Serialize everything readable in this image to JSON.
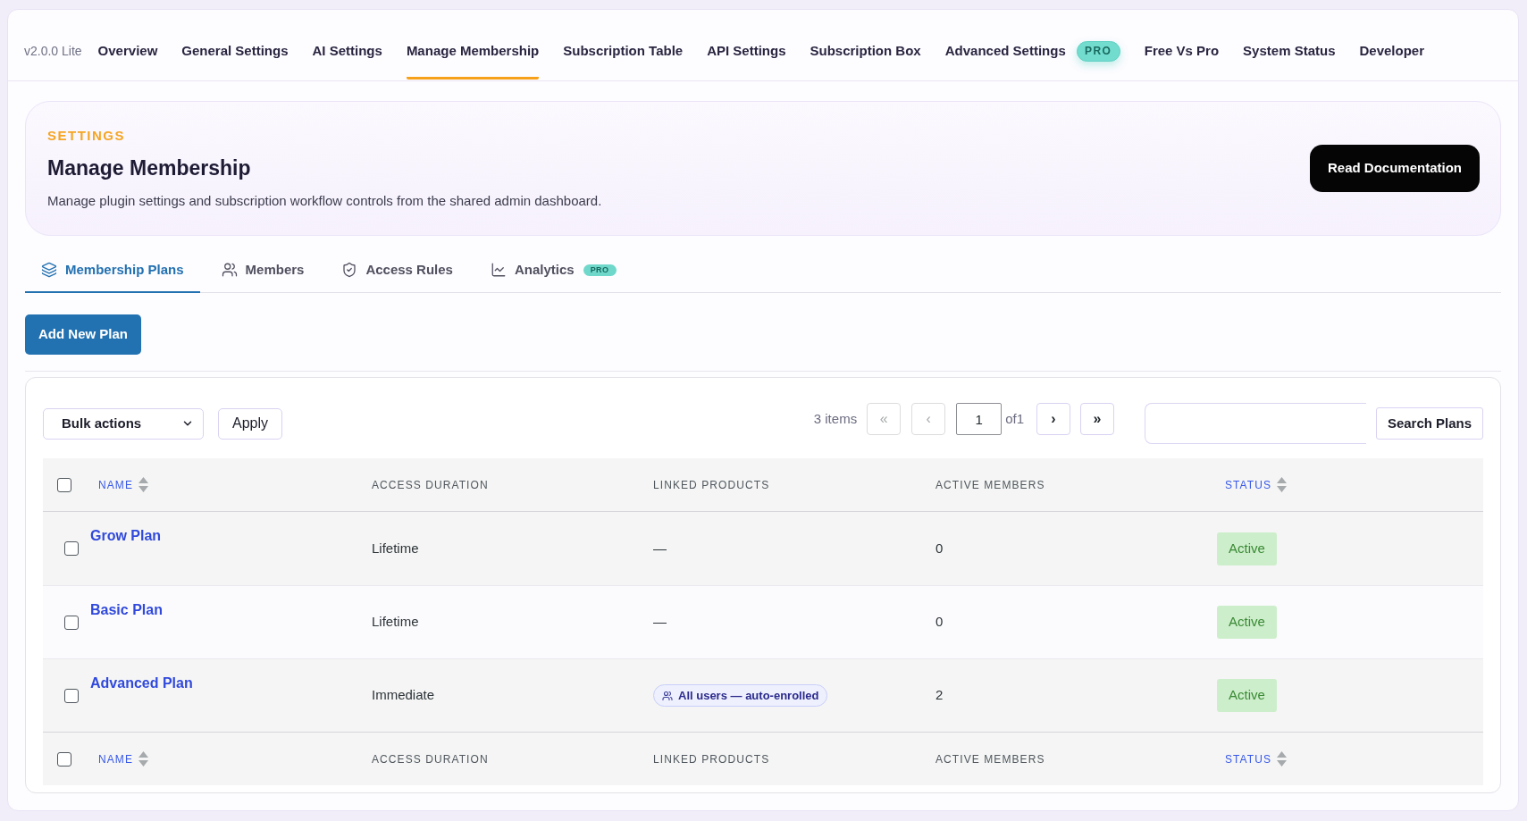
{
  "nav": {
    "version": "v2.0.0 Lite",
    "items": [
      {
        "label": "Overview",
        "selected": false
      },
      {
        "label": "General Settings",
        "selected": false
      },
      {
        "label": "AI Settings",
        "selected": false
      },
      {
        "label": "Manage Membership",
        "selected": true
      },
      {
        "label": "Subscription Table",
        "selected": false
      },
      {
        "label": "API Settings",
        "selected": false
      },
      {
        "label": "Subscription Box",
        "selected": false
      },
      {
        "label": "Advanced Settings",
        "selected": false,
        "badge": "PRO"
      },
      {
        "label": "Free Vs Pro",
        "selected": false
      },
      {
        "label": "System Status",
        "selected": false
      },
      {
        "label": "Developer",
        "selected": false
      }
    ]
  },
  "header": {
    "eyebrow": "SETTINGS",
    "title": "Manage Membership",
    "description": "Manage plugin settings and subscription workflow controls from the shared admin dashboard.",
    "button": "Read Documentation"
  },
  "tabs": [
    {
      "label": "Membership Plans",
      "selected": true
    },
    {
      "label": "Members",
      "selected": false
    },
    {
      "label": "Access Rules",
      "selected": false
    },
    {
      "label": "Analytics",
      "selected": false,
      "badge": "PRO"
    }
  ],
  "add_button": "Add New Plan",
  "toolbar": {
    "bulk_actions": "Bulk actions",
    "apply": "Apply",
    "item_count": "3 items",
    "pagination": {
      "first": {
        "label": "«",
        "disabled": true
      },
      "prev": {
        "label": "‹",
        "disabled": true
      },
      "page": "1",
      "of": "of1",
      "next": {
        "label": "›",
        "disabled": false
      },
      "last": {
        "label": "»",
        "disabled": false
      }
    },
    "search_button": "Search Plans"
  },
  "table": {
    "header": {
      "checked": false,
      "columns": [
        {
          "label": "NAME",
          "sortable": true
        },
        {
          "label": "ACCESS DURATION",
          "sortable": false
        },
        {
          "label": "LINKED PRODUCTS",
          "sortable": false
        },
        {
          "label": "ACTIVE MEMBERS",
          "sortable": false
        },
        {
          "label": "STATUS",
          "sortable": true
        }
      ]
    },
    "rows": [
      {
        "checked": false,
        "name": "Grow Plan",
        "access_duration": "Lifetime",
        "linked_products": {
          "kind": "text",
          "text": "—"
        },
        "active_members": "0",
        "status": "Active"
      },
      {
        "checked": false,
        "name": "Basic Plan",
        "access_duration": "Lifetime",
        "linked_products": {
          "kind": "text",
          "text": "—"
        },
        "active_members": "0",
        "status": "Active"
      },
      {
        "checked": false,
        "name": "Advanced Plan",
        "access_duration": "Immediate",
        "linked_products": {
          "kind": "tag",
          "text": "All users — auto-enrolled"
        },
        "active_members": "2",
        "status": "Active"
      }
    ],
    "footer": {
      "checked": false,
      "columns": [
        {
          "label": "NAME",
          "sortable": true
        },
        {
          "label": "ACCESS DURATION",
          "sortable": false
        },
        {
          "label": "LINKED PRODUCTS",
          "sortable": false
        },
        {
          "label": "ACTIVE MEMBERS",
          "sortable": false
        },
        {
          "label": "STATUS",
          "sortable": true
        }
      ]
    }
  }
}
